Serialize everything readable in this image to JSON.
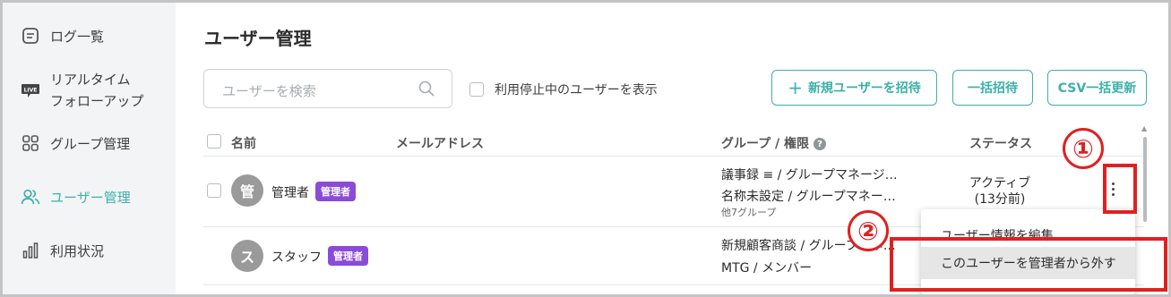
{
  "sidebar": {
    "items": [
      {
        "label": "ログ一覧",
        "icon": "document-list-icon"
      },
      {
        "label_line1": "リアルタイム",
        "label_line2": "フォローアップ",
        "icon": "live-icon"
      },
      {
        "label": "グループ管理",
        "icon": "grid-icon"
      },
      {
        "label": "ユーザー管理",
        "icon": "users-icon",
        "active": true
      },
      {
        "label": "利用状況",
        "icon": "bar-chart-icon"
      }
    ]
  },
  "main": {
    "title": "ユーザー管理",
    "search": {
      "placeholder": "ユーザーを検索"
    },
    "show_suspended_label": "利用停止中のユーザーを表示",
    "buttons": {
      "invite": "新規ユーザーを招待",
      "bulk_invite": "一括招待",
      "csv_update": "CSV一括更新"
    },
    "table": {
      "headers": {
        "name": "名前",
        "email": "メールアドレス",
        "group_role": "グループ / 権限",
        "status": "ステータス"
      },
      "rows": [
        {
          "avatar": "管",
          "name": "管理者",
          "badge": "管理者",
          "groups": [
            "議事録 ≡ / グループマネージ…",
            "名称未設定 / グループマネー…"
          ],
          "groups_more": "他7グループ",
          "status_line1": "アクティブ",
          "status_line2": "(13分前)"
        },
        {
          "avatar": "ス",
          "name": "スタッフ",
          "badge": "管理者",
          "groups": [
            "新規顧客商談 / グループマネ…",
            "MTG / メンバー"
          ]
        }
      ]
    },
    "menu": {
      "items": [
        "ユーザー情報を編集",
        "このユーザーを管理者から外す"
      ]
    }
  },
  "annotations": {
    "step1": "①",
    "step2": "②"
  },
  "colors": {
    "accent": "#3bb1a9",
    "badge": "#8b4bd9",
    "annotation": "#e02020",
    "sidebar_bg": "#f3f4f6"
  }
}
